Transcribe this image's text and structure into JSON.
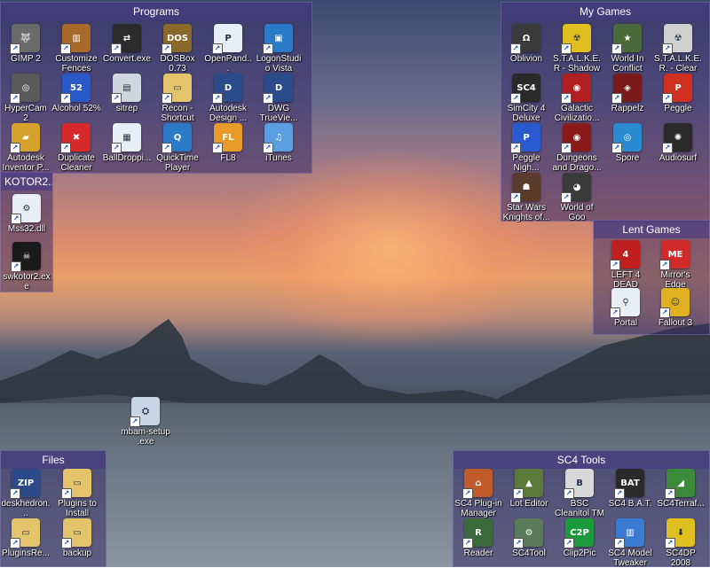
{
  "fences": {
    "programs": {
      "title": "Programs",
      "items": [
        {
          "label": "GIMP 2",
          "icon": "gimp-icon",
          "color": "#6b6b6b",
          "glyph": "🐺"
        },
        {
          "label": "Customize Fences",
          "icon": "fences-icon",
          "color": "#a86a2a",
          "glyph": "▥"
        },
        {
          "label": "Convert.exe",
          "icon": "convert-arrows-icon",
          "color": "#2b2b2b",
          "glyph": "⇄"
        },
        {
          "label": "DOSBox 0.73",
          "icon": "dosbox-icon",
          "color": "#8a6a2a",
          "glyph": "DOS"
        },
        {
          "label": "OpenPand...",
          "icon": "openpandora-icon",
          "color": "#e8eef5",
          "glyph": "P"
        },
        {
          "label": "LogonStudio Vista",
          "icon": "logonstudio-icon",
          "color": "#2a7ac8",
          "glyph": "▣"
        },
        {
          "label": "HyperCam 2",
          "icon": "hypercam-icon",
          "color": "#5a5a5a",
          "glyph": "◎"
        },
        {
          "label": "Alcohol 52%",
          "icon": "alcohol-icon",
          "color": "#2a58c8",
          "glyph": "52"
        },
        {
          "label": "sitrep",
          "icon": "sitrep-icon",
          "color": "#cfd6de",
          "glyph": "▤"
        },
        {
          "label": "Recon - Shortcut",
          "icon": "folder-icon",
          "color": "#e3c46a",
          "glyph": "▭"
        },
        {
          "label": "Autodesk Design ...",
          "icon": "autodesk-design-icon",
          "color": "#2a4c8a",
          "glyph": "D"
        },
        {
          "label": "DWG TrueVie...",
          "icon": "dwg-trueview-icon",
          "color": "#2a4c8a",
          "glyph": "D"
        },
        {
          "label": "Autodesk Inventor P...",
          "icon": "inventor-icon",
          "color": "#d4a12a",
          "glyph": "▰"
        },
        {
          "label": "Duplicate Cleaner",
          "icon": "duplicate-cleaner-icon",
          "color": "#d8292a",
          "glyph": "✖"
        },
        {
          "label": "BallDroppi...",
          "icon": "balldropping-icon",
          "color": "#e8eef5",
          "glyph": "▦"
        },
        {
          "label": "QuickTime Player",
          "icon": "quicktime-icon",
          "color": "#2a7ac8",
          "glyph": "Q"
        },
        {
          "label": "FL8",
          "icon": "fl-studio-icon",
          "color": "#e89a2a",
          "glyph": "FL"
        },
        {
          "label": "iTunes",
          "icon": "itunes-icon",
          "color": "#5aa0e0",
          "glyph": "♫"
        }
      ]
    },
    "my_games": {
      "title": "My Games",
      "items": [
        {
          "label": "Oblivion",
          "icon": "oblivion-icon",
          "color": "#3a3a3a",
          "glyph": "Ω"
        },
        {
          "label": "S.T.A.L.K.E.R - Shadow ...",
          "icon": "stalker-shadow-icon",
          "color": "#e0c020",
          "glyph": "☢"
        },
        {
          "label": "World In Conflict",
          "icon": "world-in-conflict-icon",
          "color": "#4a6a3a",
          "glyph": "★"
        },
        {
          "label": "S.T.A.L.K.E.R. - Clear Sky",
          "icon": "stalker-clearsky-icon",
          "color": "#d0d0d0",
          "glyph": "☢"
        },
        {
          "label": "SimCity 4 Deluxe",
          "icon": "simcity4-icon",
          "color": "#2a2a2a",
          "glyph": "SC4"
        },
        {
          "label": "Galactic Civilizatio...",
          "icon": "galactic-civ-icon",
          "color": "#b02020",
          "glyph": "◉"
        },
        {
          "label": "Rappelz",
          "icon": "rappelz-icon",
          "color": "#7a1a1a",
          "glyph": "◈"
        },
        {
          "label": "Peggle",
          "icon": "peggle-icon",
          "color": "#d03020",
          "glyph": "P"
        },
        {
          "label": "Peggle Nigh...",
          "icon": "peggle-nights-icon",
          "color": "#2a5ad0",
          "glyph": "P"
        },
        {
          "label": "Dungeons and Drago...",
          "icon": "dungeons-dragons-icon",
          "color": "#8a1a1a",
          "glyph": "◉"
        },
        {
          "label": "Spore",
          "icon": "spore-icon",
          "color": "#2a8ad0",
          "glyph": "◎"
        },
        {
          "label": "Audiosurf",
          "icon": "audiosurf-icon",
          "color": "#2a2a2a",
          "glyph": "✺"
        },
        {
          "label": "Star Wars Knights of...",
          "icon": "star-wars-kotor-icon",
          "color": "#5a3a2a",
          "glyph": "☗"
        },
        {
          "label": "World of Goo",
          "icon": "world-of-goo-icon",
          "color": "#3a3a3a",
          "glyph": "◕"
        }
      ]
    },
    "kotor": {
      "title": "KOTOR2...",
      "items": [
        {
          "label": "Mss32.dll",
          "icon": "dll-file-icon",
          "color": "#e8eef5",
          "glyph": "⚙"
        },
        {
          "label": "swkotor2.exe",
          "icon": "swkotor2-icon",
          "color": "#1a1a1a",
          "glyph": "☠"
        }
      ]
    },
    "lent_games": {
      "title": "Lent Games",
      "items": [
        {
          "label": "LEFT 4 DEAD",
          "icon": "left4dead-icon",
          "color": "#c02020",
          "glyph": "4"
        },
        {
          "label": "Mirror's Edge",
          "icon": "mirrors-edge-icon",
          "color": "#d02a2a",
          "glyph": "ME"
        },
        {
          "label": "Portal",
          "icon": "portal-icon",
          "color": "#e8eef5",
          "glyph": "⚲"
        },
        {
          "label": "Fallout 3",
          "icon": "fallout3-icon",
          "color": "#e0b020",
          "glyph": "☺"
        }
      ]
    },
    "files": {
      "title": "Files",
      "items": [
        {
          "label": "deskhedron...",
          "icon": "zip-archive-icon",
          "color": "#2a4a8a",
          "glyph": "ZIP"
        },
        {
          "label": "Plugins to Install",
          "icon": "folder-icon",
          "color": "#e3c46a",
          "glyph": "▭"
        },
        {
          "label": "PluginsRe...",
          "icon": "folder-icon",
          "color": "#e3c46a",
          "glyph": "▭"
        },
        {
          "label": "backup",
          "icon": "folder-icon",
          "color": "#e3c46a",
          "glyph": "▭"
        }
      ]
    },
    "sc4_tools": {
      "title": "SC4 Tools",
      "items": [
        {
          "label": "SC4 Plug-in Manager",
          "icon": "sc4-plugin-manager-icon",
          "color": "#c05a2a",
          "glyph": "⌂"
        },
        {
          "label": "Lot Editor",
          "icon": "lot-editor-icon",
          "color": "#5a7a3a",
          "glyph": "▲"
        },
        {
          "label": "BSC Cleanitol TM",
          "icon": "cleanitol-icon",
          "color": "#d8d8d8",
          "glyph": "B"
        },
        {
          "label": "SC4 B.A.T.",
          "icon": "sc4-bat-icon",
          "color": "#2a2a2a",
          "glyph": "BAT"
        },
        {
          "label": "SC4Terraf...",
          "icon": "sc4-terraformer-icon",
          "color": "#3a8a3a",
          "glyph": "◢"
        },
        {
          "label": "Reader",
          "icon": "sc4-reader-icon",
          "color": "#3a6a3a",
          "glyph": "R"
        },
        {
          "label": "SC4Tool",
          "icon": "sc4tool-icon",
          "color": "#5a7a5a",
          "glyph": "⚙"
        },
        {
          "label": "Clip2Pic",
          "icon": "clip2pic-icon",
          "color": "#1a9a3a",
          "glyph": "C2P"
        },
        {
          "label": "SC4 Model Tweaker",
          "icon": "sc4-model-tweaker-icon",
          "color": "#3a7ad0",
          "glyph": "▥"
        },
        {
          "label": "SC4DP 2008",
          "icon": "sc4dp-icon",
          "color": "#e0c020",
          "glyph": "⬇"
        }
      ]
    }
  },
  "desktop_items": [
    {
      "label": "mbam-setup .exe",
      "icon": "installer-icon",
      "color": "#c8d6e6",
      "glyph": "⛭"
    }
  ]
}
